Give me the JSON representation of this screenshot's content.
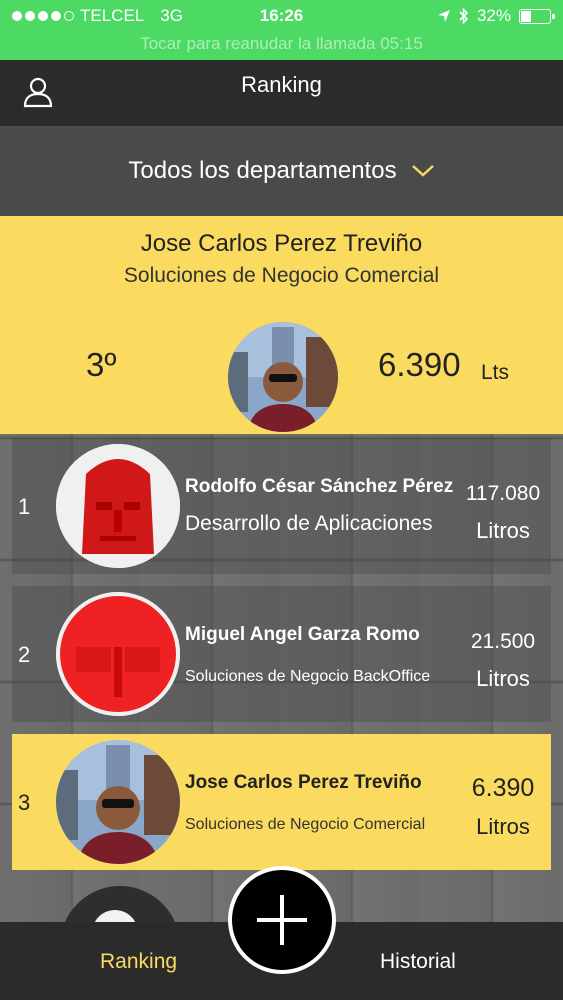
{
  "status_bar": {
    "carrier": "TELCEL",
    "network": "3G",
    "time": "16:26",
    "battery": "32%",
    "battery_level": 0.32,
    "call_banner": "Tocar para reanudar la llamada 05:15",
    "signal_bars": 4
  },
  "nav": {
    "title": "Ranking",
    "user_icon": "person-icon"
  },
  "department_filter": {
    "label": "Todos los departamentos",
    "icon": "chevron-down-icon"
  },
  "current_user": {
    "name": "Jose Carlos Perez Treviño",
    "department": "Soluciones de Negocio Comercial",
    "rank": "3º",
    "liters": "6.390",
    "unit": "Lts"
  },
  "ranking": [
    {
      "rank": "1",
      "name": "Rodolfo César Sánchez Pérez",
      "department": "Desarrollo de Aplicaciones",
      "value": "117.080",
      "unit": "Litros",
      "avatar": "red-mask"
    },
    {
      "rank": "2",
      "name": "Miguel Angel Garza Romo",
      "department": "Soluciones de Negocio BackOffice",
      "value": "21.500",
      "unit": "Litros",
      "avatar": "red-mask"
    },
    {
      "rank": "3",
      "name": "Jose Carlos Perez Treviño",
      "department": "Soluciones de Negocio Comercial",
      "value": "6.390",
      "unit": "Litros",
      "avatar": "photo"
    }
  ],
  "tabs": {
    "ranking": "Ranking",
    "historial": "Historial",
    "add_icon": "plus-icon"
  },
  "colors": {
    "accent": "#fadb5f",
    "status_green": "#4cd964",
    "dark_bar": "#2b2b2b"
  }
}
